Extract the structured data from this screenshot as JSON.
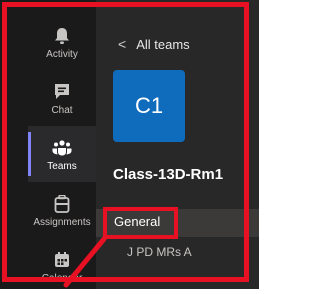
{
  "rail": {
    "items": [
      {
        "label": "Activity",
        "icon": "bell-icon"
      },
      {
        "label": "Chat",
        "icon": "chat-icon"
      },
      {
        "label": "Teams",
        "icon": "teams-icon",
        "active": true
      },
      {
        "label": "Assignments",
        "icon": "assignments-icon"
      },
      {
        "label": "Calendar",
        "icon": "calendar-icon"
      }
    ]
  },
  "panel": {
    "back_label": "All teams",
    "back_glyph": "<",
    "tile_text": "C1",
    "team_name": "Class-13D-Rm1",
    "channels": [
      "General",
      "J PD MRs A"
    ]
  },
  "colors": {
    "annotation": "#e81123",
    "accent": "#7f85f5",
    "tile": "#0f6cbd"
  }
}
